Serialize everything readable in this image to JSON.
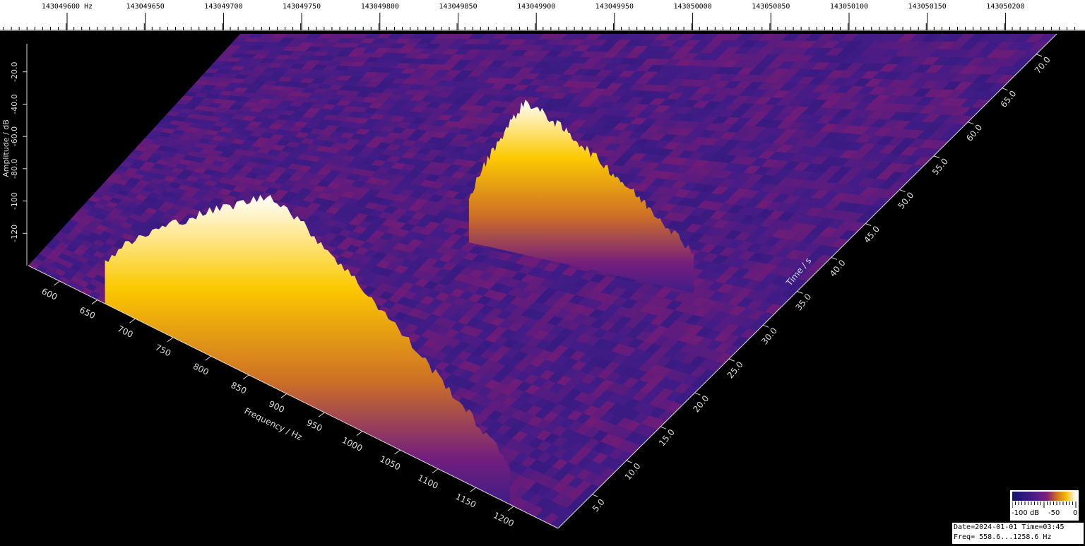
{
  "top_axis": {
    "labels": [
      "143049600 Hz",
      "143049650",
      "143049700",
      "143049750",
      "143049800",
      "143049850",
      "143049900",
      "143049950",
      "143050000",
      "143050050",
      "143050100",
      "143050150",
      "143050200"
    ]
  },
  "legend": {
    "min_label": "-100 dB",
    "mid_label": "-50",
    "max_label": "0"
  },
  "info": {
    "date_line": "Date=2024-01-01 Time=03:45",
    "freq_line": "Freq= 558.6...1258.6 Hz"
  },
  "colors": {
    "background": "#000000",
    "floor": "#3a1a7a",
    "low": "#1a1a6e",
    "mid": "#7a1a6e",
    "high": "#f5a000",
    "peak": "#ffffff"
  },
  "chart_data": {
    "type": "3d-waterfall",
    "title": "",
    "freq_axis": {
      "label": "Frequency / Hz",
      "ticks": [
        "600",
        "650",
        "700",
        "750",
        "800",
        "850",
        "900",
        "950",
        "1000",
        "1050",
        "1100",
        "1150",
        "1200"
      ],
      "range": [
        558.6,
        1258.6
      ]
    },
    "time_axis": {
      "label": "Time / s",
      "ticks": [
        "5.0",
        "10.0",
        "15.0",
        "20.0",
        "25.0",
        "30.0",
        "35.0",
        "40.0",
        "45.0",
        "50.0",
        "55.0",
        "60.0",
        "65.0",
        "70.0"
      ],
      "range": [
        0,
        73
      ]
    },
    "amp_axis": {
      "label": "Amplitude / dB",
      "ticks": [
        "-20.0",
        "-40.0",
        "-60.0",
        "-80.0",
        "-100",
        "-120"
      ],
      "range": [
        -140,
        0
      ]
    },
    "noise_floor_db": -115,
    "signals": [
      {
        "freq_start": 660,
        "freq_end": 1195,
        "freq_peak": 880,
        "peak_db": -22,
        "time": 0
      },
      {
        "freq_start": 930,
        "freq_end": 1170,
        "freq_peak": 990,
        "peak_db": -45,
        "time": 32
      }
    ]
  }
}
